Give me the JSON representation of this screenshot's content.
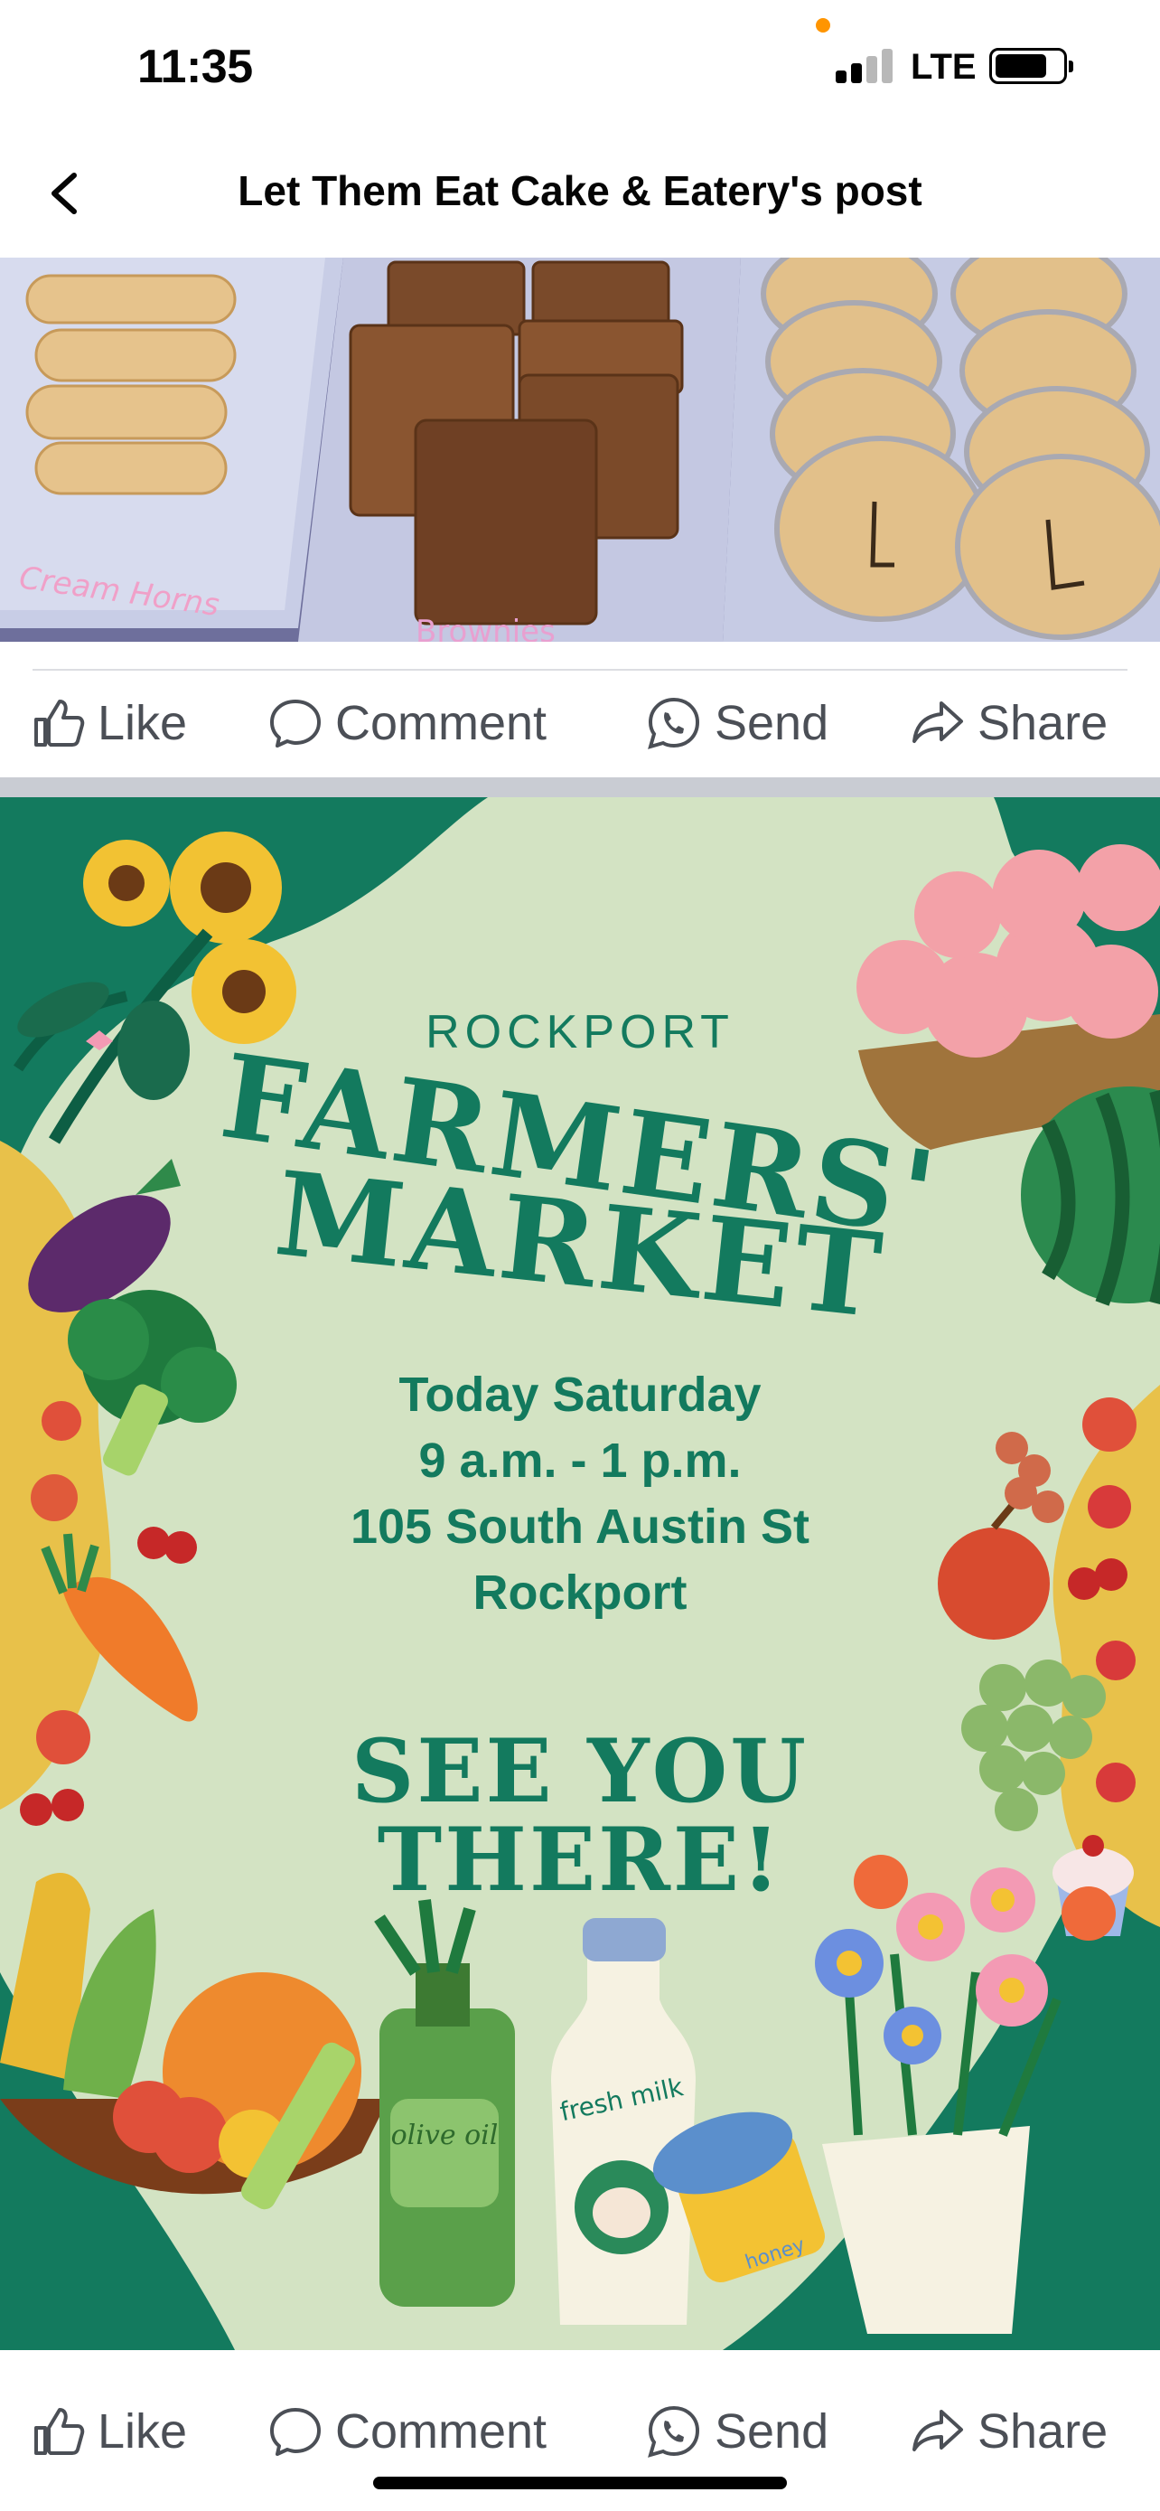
{
  "status_bar": {
    "time": "11:35",
    "network": "LTE",
    "icons": [
      "signal-icon",
      "battery-icon"
    ]
  },
  "nav": {
    "title": "Let Them Eat Cake & Eatery's post",
    "back_icon": "chevron-left-icon"
  },
  "photo": {
    "labels": [
      "Cream Horns",
      "Brownies"
    ]
  },
  "actions": {
    "like": "Like",
    "comment": "Comment",
    "send": "Send",
    "share": "Share"
  },
  "flyer": {
    "city": "ROCKPORT",
    "title_line1": "FARMERS'",
    "title_line2": "MARKET",
    "day": "Today Saturday",
    "hours": "9 a.m. - 1 p.m.",
    "address": "105 South Austin St",
    "town": "Rockport",
    "cta_line1": "SEE YOU",
    "cta_line2": "THERE!",
    "item_labels": {
      "oil": "olive oil",
      "milk": "fresh milk",
      "honey": "honey"
    }
  },
  "colors": {
    "flyer_bg": "#d3e3c3",
    "flyer_text": "#137a5e",
    "teal": "#137a5e",
    "action_text": "#4b4f56"
  }
}
